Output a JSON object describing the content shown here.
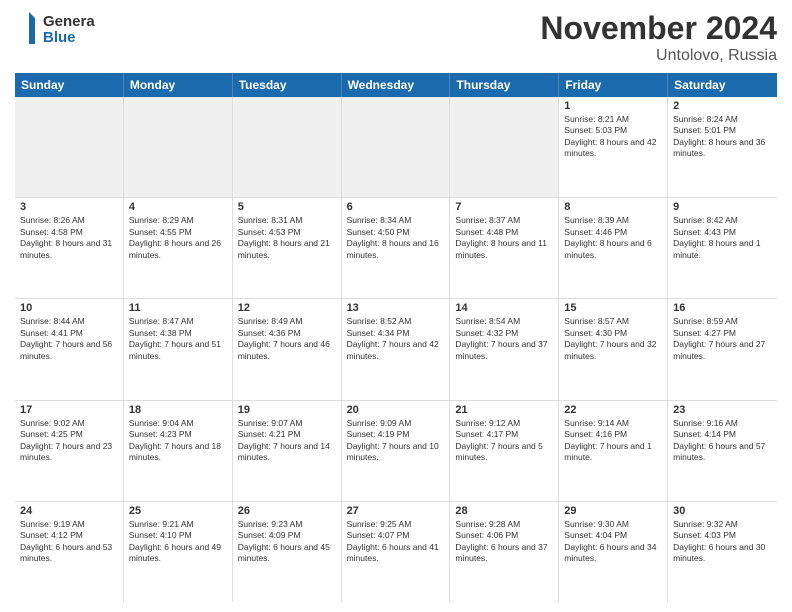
{
  "header": {
    "logo_line1": "General",
    "logo_line2": "Blue",
    "month": "November 2024",
    "location": "Untolovo, Russia"
  },
  "days_of_week": [
    "Sunday",
    "Monday",
    "Tuesday",
    "Wednesday",
    "Thursday",
    "Friday",
    "Saturday"
  ],
  "rows": [
    {
      "cells": [
        {
          "day": "",
          "empty": true
        },
        {
          "day": "",
          "empty": true
        },
        {
          "day": "",
          "empty": true
        },
        {
          "day": "",
          "empty": true
        },
        {
          "day": "",
          "empty": true
        },
        {
          "day": "1",
          "sunrise": "8:21 AM",
          "sunset": "5:03 PM",
          "daylight": "8 hours and 42 minutes."
        },
        {
          "day": "2",
          "sunrise": "8:24 AM",
          "sunset": "5:01 PM",
          "daylight": "8 hours and 36 minutes."
        }
      ]
    },
    {
      "cells": [
        {
          "day": "3",
          "sunrise": "8:26 AM",
          "sunset": "4:58 PM",
          "daylight": "8 hours and 31 minutes."
        },
        {
          "day": "4",
          "sunrise": "8:29 AM",
          "sunset": "4:55 PM",
          "daylight": "8 hours and 26 minutes."
        },
        {
          "day": "5",
          "sunrise": "8:31 AM",
          "sunset": "4:53 PM",
          "daylight": "8 hours and 21 minutes."
        },
        {
          "day": "6",
          "sunrise": "8:34 AM",
          "sunset": "4:50 PM",
          "daylight": "8 hours and 16 minutes."
        },
        {
          "day": "7",
          "sunrise": "8:37 AM",
          "sunset": "4:48 PM",
          "daylight": "8 hours and 11 minutes."
        },
        {
          "day": "8",
          "sunrise": "8:39 AM",
          "sunset": "4:46 PM",
          "daylight": "8 hours and 6 minutes."
        },
        {
          "day": "9",
          "sunrise": "8:42 AM",
          "sunset": "4:43 PM",
          "daylight": "8 hours and 1 minute."
        }
      ]
    },
    {
      "cells": [
        {
          "day": "10",
          "sunrise": "8:44 AM",
          "sunset": "4:41 PM",
          "daylight": "7 hours and 56 minutes."
        },
        {
          "day": "11",
          "sunrise": "8:47 AM",
          "sunset": "4:38 PM",
          "daylight": "7 hours and 51 minutes."
        },
        {
          "day": "12",
          "sunrise": "8:49 AM",
          "sunset": "4:36 PM",
          "daylight": "7 hours and 46 minutes."
        },
        {
          "day": "13",
          "sunrise": "8:52 AM",
          "sunset": "4:34 PM",
          "daylight": "7 hours and 42 minutes."
        },
        {
          "day": "14",
          "sunrise": "8:54 AM",
          "sunset": "4:32 PM",
          "daylight": "7 hours and 37 minutes."
        },
        {
          "day": "15",
          "sunrise": "8:57 AM",
          "sunset": "4:30 PM",
          "daylight": "7 hours and 32 minutes."
        },
        {
          "day": "16",
          "sunrise": "8:59 AM",
          "sunset": "4:27 PM",
          "daylight": "7 hours and 27 minutes."
        }
      ]
    },
    {
      "cells": [
        {
          "day": "17",
          "sunrise": "9:02 AM",
          "sunset": "4:25 PM",
          "daylight": "7 hours and 23 minutes."
        },
        {
          "day": "18",
          "sunrise": "9:04 AM",
          "sunset": "4:23 PM",
          "daylight": "7 hours and 18 minutes."
        },
        {
          "day": "19",
          "sunrise": "9:07 AM",
          "sunset": "4:21 PM",
          "daylight": "7 hours and 14 minutes."
        },
        {
          "day": "20",
          "sunrise": "9:09 AM",
          "sunset": "4:19 PM",
          "daylight": "7 hours and 10 minutes."
        },
        {
          "day": "21",
          "sunrise": "9:12 AM",
          "sunset": "4:17 PM",
          "daylight": "7 hours and 5 minutes."
        },
        {
          "day": "22",
          "sunrise": "9:14 AM",
          "sunset": "4:16 PM",
          "daylight": "7 hours and 1 minute."
        },
        {
          "day": "23",
          "sunrise": "9:16 AM",
          "sunset": "4:14 PM",
          "daylight": "6 hours and 57 minutes."
        }
      ]
    },
    {
      "cells": [
        {
          "day": "24",
          "sunrise": "9:19 AM",
          "sunset": "4:12 PM",
          "daylight": "6 hours and 53 minutes."
        },
        {
          "day": "25",
          "sunrise": "9:21 AM",
          "sunset": "4:10 PM",
          "daylight": "6 hours and 49 minutes."
        },
        {
          "day": "26",
          "sunrise": "9:23 AM",
          "sunset": "4:09 PM",
          "daylight": "6 hours and 45 minutes."
        },
        {
          "day": "27",
          "sunrise": "9:25 AM",
          "sunset": "4:07 PM",
          "daylight": "6 hours and 41 minutes."
        },
        {
          "day": "28",
          "sunrise": "9:28 AM",
          "sunset": "4:06 PM",
          "daylight": "6 hours and 37 minutes."
        },
        {
          "day": "29",
          "sunrise": "9:30 AM",
          "sunset": "4:04 PM",
          "daylight": "6 hours and 34 minutes."
        },
        {
          "day": "30",
          "sunrise": "9:32 AM",
          "sunset": "4:03 PM",
          "daylight": "6 hours and 30 minutes."
        }
      ]
    }
  ]
}
